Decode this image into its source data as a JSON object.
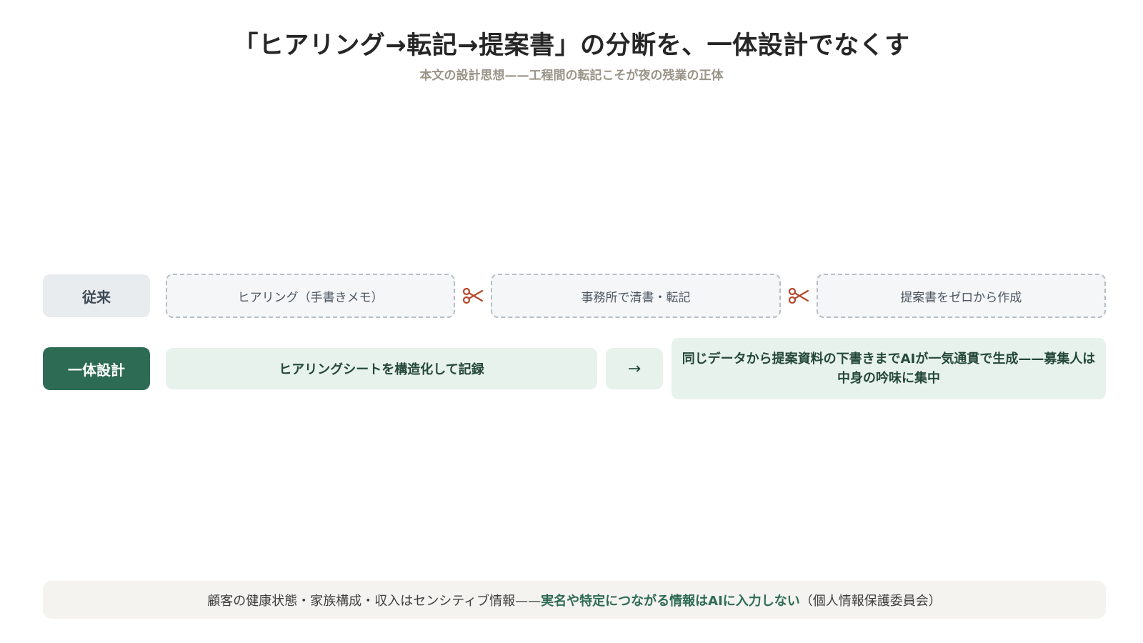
{
  "header": {
    "title": "「ヒアリング→転記→提案書」の分断を、一体設計でなくす",
    "subtitle": "本文の設計思想——工程間の転記こそが夜の残業の正体"
  },
  "rows": {
    "old": {
      "label": "従来",
      "steps": [
        "ヒアリング（手書きメモ）",
        "事務所で清書・転記",
        "提案書をゼロから作成"
      ]
    },
    "new": {
      "label": "一体設計",
      "step1": "ヒアリングシートを構造化して記録",
      "arrow": "→",
      "step2": "同じデータから提案資料の下書きまでAIが一気通貫で生成——募集人は中身の吟味に集中"
    }
  },
  "footnote": {
    "before": "顧客の健康状態・家族構成・収入はセンシティブ情報——",
    "emphasis": "実名や特定につながる情報はAIに入力しない",
    "after": "（個人情報保護委員会）"
  },
  "colors": {
    "accent": "#2e6b55",
    "cut": "#b5472a"
  },
  "icons": {
    "cut": "scissors-icon"
  }
}
